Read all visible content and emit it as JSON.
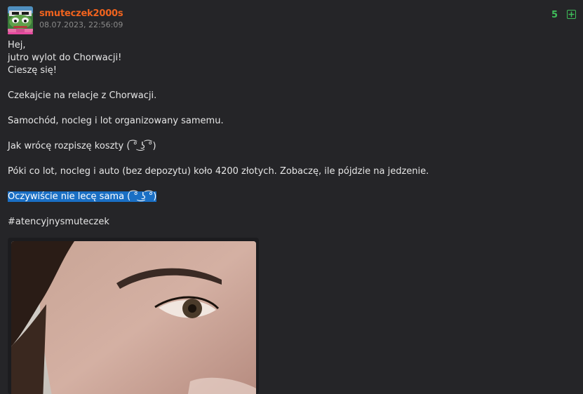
{
  "post": {
    "username": "smuteczek2000s",
    "timestamp": "08.07.2023, 22:56:09",
    "vote_count": "5",
    "colors": {
      "username": "#f0631e",
      "votes": "#3fbe5a",
      "selection": "#1a6fc4"
    },
    "avatar_icon": "pepe-frog-avatar-icon",
    "plus_icon": "plus-icon",
    "lines": [
      "Hej,",
      "jutro wylot do Chorwacji!",
      "Cieszę się!",
      "Czekajcie na relacje z Chorwacji.",
      "Samochód, nocleg i lot organizowany samemu.",
      "Jak wrócę rozpiszę koszty ( ͡° ͜ʖ ͡°)",
      "Póki co lot, nocleg i auto (bez depozytu) koło 4200 złotych. Zobaczę, ile pójdzie na jedzenie.",
      "Oczywiście nie lecę sama ( ͡° ͜ʖ ͡°)",
      "#atencyjnysmuteczek"
    ]
  }
}
